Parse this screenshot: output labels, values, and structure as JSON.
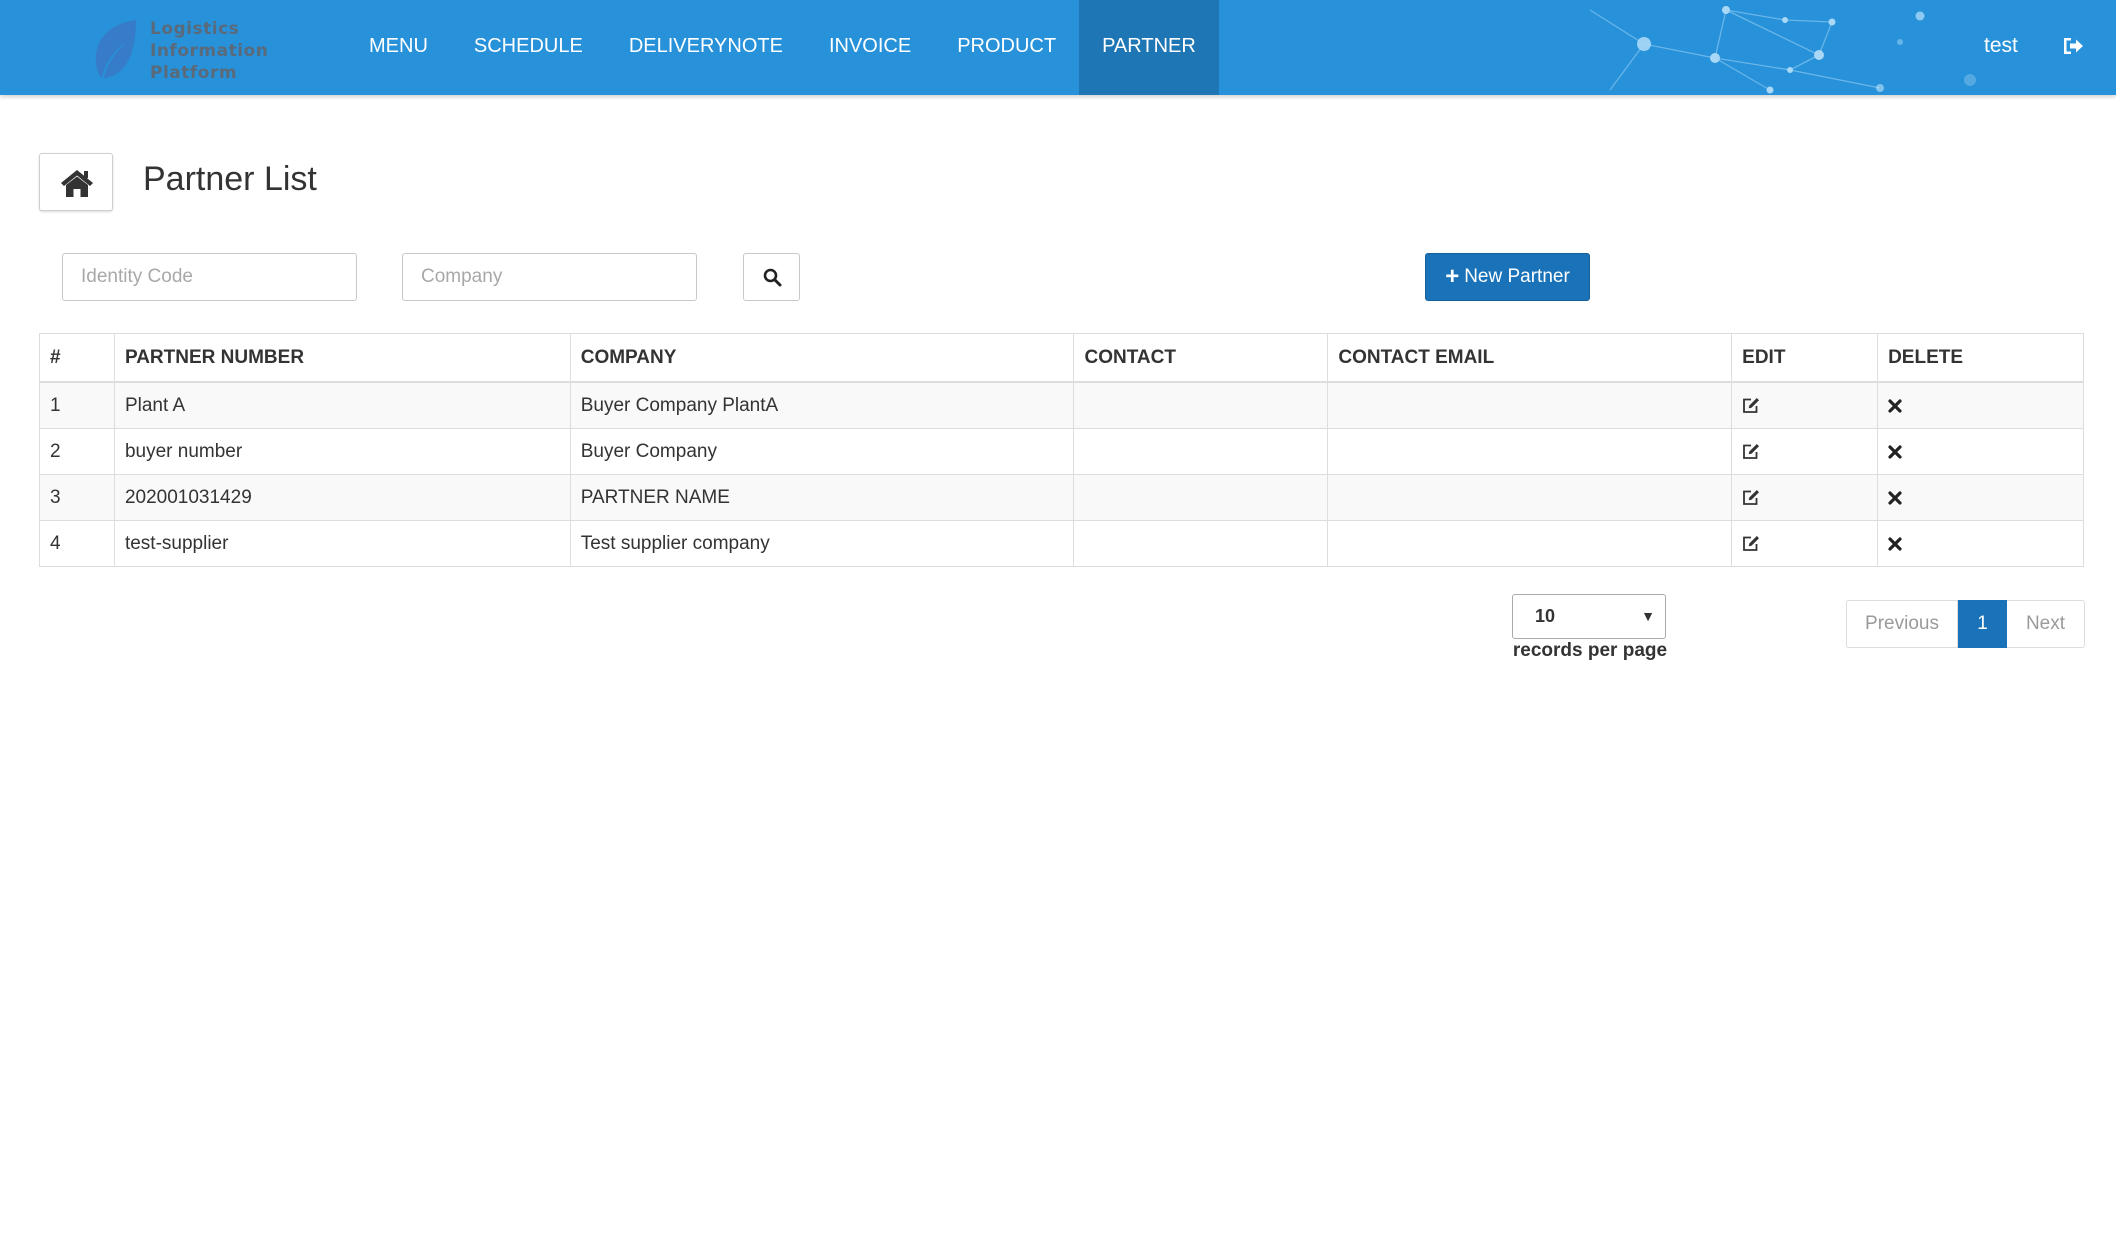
{
  "app": {
    "logo_lines": [
      "Logistics",
      "Information",
      "Platform"
    ],
    "brand_color": "#2791d9",
    "active_nav_color": "#1e76b4",
    "primary_button_color": "#1a73b8"
  },
  "nav": {
    "items": [
      {
        "label": "MENU"
      },
      {
        "label": "SCHEDULE"
      },
      {
        "label": "DELIVERYNOTE"
      },
      {
        "label": "INVOICE"
      },
      {
        "label": "PRODUCT"
      },
      {
        "label": "PARTNER"
      }
    ],
    "active": "PARTNER"
  },
  "user": {
    "name": "test",
    "logout_icon": "sign-out-icon"
  },
  "page": {
    "title": "Partner List",
    "home_icon": "home-icon"
  },
  "filters": {
    "identity_code": {
      "value": "",
      "placeholder": "Identity Code"
    },
    "company": {
      "value": "",
      "placeholder": "Company"
    },
    "search_icon": "search-icon",
    "new_button_label": "New Partner"
  },
  "table": {
    "columns": [
      "#",
      "PARTNER NUMBER",
      "COMPANY",
      "CONTACT",
      "CONTACT EMAIL",
      "EDIT",
      "DELETE"
    ],
    "rows": [
      {
        "index": "1",
        "partner_number": "Plant A",
        "company": "Buyer Company PlantA",
        "contact": "",
        "contact_email": ""
      },
      {
        "index": "2",
        "partner_number": "buyer number",
        "company": "Buyer Company",
        "contact": "",
        "contact_email": ""
      },
      {
        "index": "3",
        "partner_number": "202001031429",
        "company": "PARTNER NAME",
        "contact": "",
        "contact_email": ""
      },
      {
        "index": "4",
        "partner_number": "test-supplier",
        "company": "Test supplier company",
        "contact": "",
        "contact_email": ""
      }
    ],
    "edit_icon": "edit-icon",
    "delete_icon": "close-icon"
  },
  "pagination": {
    "page_size": "10",
    "page_size_label": "records per page",
    "previous_label": "Previous",
    "current_page": "1",
    "next_label": "Next"
  }
}
